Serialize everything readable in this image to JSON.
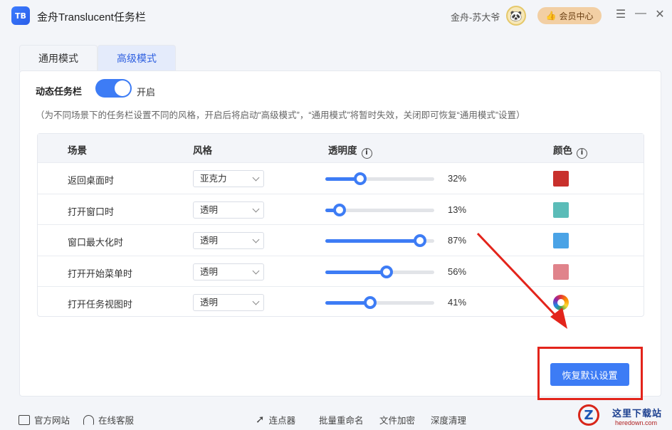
{
  "app": {
    "logo_text": "TB",
    "title": "金舟Translucent任务栏",
    "user_name": "金舟-苏大爷",
    "vip_label": "会员中心"
  },
  "window_controls": {
    "menu": "☰",
    "minimize": "—",
    "close": "✕"
  },
  "tabs": [
    {
      "label": "通用模式",
      "active": false
    },
    {
      "label": "高级模式",
      "active": true
    }
  ],
  "dynamic_taskbar": {
    "label": "动态任务栏",
    "state_text": "开启",
    "enabled": true,
    "hint": "（为不同场景下的任务栏设置不同的风格，开启后将启动“高级模式”，“通用模式”将暂时失效，关闭即可恢复“通用模式”设置）"
  },
  "table": {
    "headers": {
      "scene": "场景",
      "style": "风格",
      "opacity": "透明度",
      "color": "颜色"
    },
    "rows": [
      {
        "scene": "返回桌面时",
        "style": "亚克力",
        "opacity": 32,
        "opacity_text": "32%",
        "color": "#c8302c",
        "color_type": "solid"
      },
      {
        "scene": "打开窗口时",
        "style": "透明",
        "opacity": 13,
        "opacity_text": "13%",
        "color": "#5bbcb8",
        "color_type": "solid"
      },
      {
        "scene": "窗口最大化时",
        "style": "透明",
        "opacity": 87,
        "opacity_text": "87%",
        "color": "#4aa3e6",
        "color_type": "solid"
      },
      {
        "scene": "打开开始菜单时",
        "style": "透明",
        "opacity": 56,
        "opacity_text": "56%",
        "color": "#e0838b",
        "color_type": "solid"
      },
      {
        "scene": "打开任务视图时",
        "style": "透明",
        "opacity": 41,
        "opacity_text": "41%",
        "color": "rainbow",
        "color_type": "rainbow"
      }
    ]
  },
  "restore_button": "恢复默认设置",
  "footer": {
    "official_site": "官方网站",
    "online_service": "在线客服",
    "clicker": "连点器",
    "batch_rename": "批量重命名",
    "file_encrypt": "文件加密",
    "deep_clean": "深度清理"
  },
  "watermark": {
    "logo_letter": "Z",
    "text": "这里下载站",
    "url": "heredown.com"
  },
  "colors": {
    "accent": "#3d7cf5",
    "highlight": "#e3241b"
  }
}
